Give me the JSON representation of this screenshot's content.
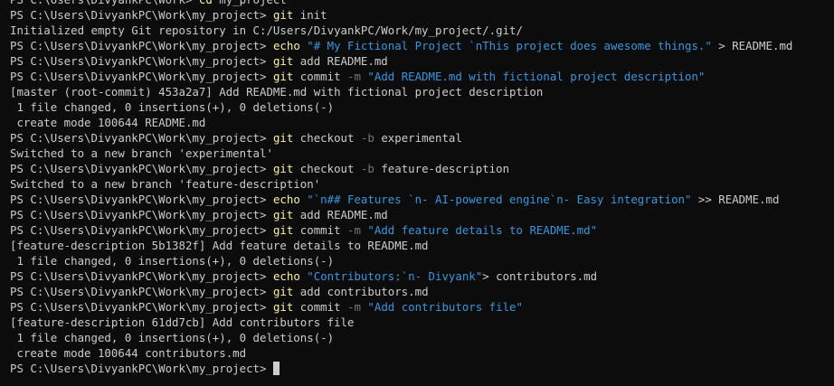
{
  "colors": {
    "background": "#0c0c0c",
    "foreground": "#cccccc",
    "command": "#f9f1a5",
    "string": "#3a96dd",
    "parameter": "#767676"
  },
  "lines": [
    [
      {
        "k": "prompt",
        "t": "PS C:\\Users\\DivyankPC\\Work> "
      },
      {
        "k": "cmd",
        "t": "cd"
      },
      {
        "k": "arg",
        "t": " my_project"
      }
    ],
    [
      {
        "k": "prompt",
        "t": "PS C:\\Users\\DivyankPC\\Work\\my_project> "
      },
      {
        "k": "cmd",
        "t": "git"
      },
      {
        "k": "arg",
        "t": " init"
      }
    ],
    [
      {
        "k": "out",
        "t": "Initialized empty Git repository in C:/Users/DivyankPC/Work/my_project/.git/"
      }
    ],
    [
      {
        "k": "prompt",
        "t": "PS C:\\Users\\DivyankPC\\Work\\my_project> "
      },
      {
        "k": "cmd",
        "t": "echo"
      },
      {
        "k": "arg",
        "t": " "
      },
      {
        "k": "str",
        "t": "\"# My Fictional Project `nThis project does awesome things.\""
      },
      {
        "k": "arg",
        "t": " > README.md"
      }
    ],
    [
      {
        "k": "prompt",
        "t": "PS C:\\Users\\DivyankPC\\Work\\my_project> "
      },
      {
        "k": "cmd",
        "t": "git"
      },
      {
        "k": "arg",
        "t": " add README.md"
      }
    ],
    [
      {
        "k": "prompt",
        "t": "PS C:\\Users\\DivyankPC\\Work\\my_project> "
      },
      {
        "k": "cmd",
        "t": "git"
      },
      {
        "k": "arg",
        "t": " commit "
      },
      {
        "k": "flag",
        "t": "-m"
      },
      {
        "k": "arg",
        "t": " "
      },
      {
        "k": "str",
        "t": "\"Add README.md with fictional project description\""
      }
    ],
    [
      {
        "k": "out",
        "t": "[master (root-commit) 453a2a7] Add README.md with fictional project description"
      }
    ],
    [
      {
        "k": "out",
        "t": " 1 file changed, 0 insertions(+), 0 deletions(-)"
      }
    ],
    [
      {
        "k": "out",
        "t": " create mode 100644 README.md"
      }
    ],
    [
      {
        "k": "prompt",
        "t": "PS C:\\Users\\DivyankPC\\Work\\my_project> "
      },
      {
        "k": "cmd",
        "t": "git"
      },
      {
        "k": "arg",
        "t": " checkout "
      },
      {
        "k": "flag",
        "t": "-b"
      },
      {
        "k": "arg",
        "t": " experimental"
      }
    ],
    [
      {
        "k": "out",
        "t": "Switched to a new branch 'experimental'"
      }
    ],
    [
      {
        "k": "prompt",
        "t": "PS C:\\Users\\DivyankPC\\Work\\my_project> "
      },
      {
        "k": "cmd",
        "t": "git"
      },
      {
        "k": "arg",
        "t": " checkout "
      },
      {
        "k": "flag",
        "t": "-b"
      },
      {
        "k": "arg",
        "t": " feature-description"
      }
    ],
    [
      {
        "k": "out",
        "t": "Switched to a new branch 'feature-description'"
      }
    ],
    [
      {
        "k": "prompt",
        "t": "PS C:\\Users\\DivyankPC\\Work\\my_project> "
      },
      {
        "k": "cmd",
        "t": "echo"
      },
      {
        "k": "arg",
        "t": " "
      },
      {
        "k": "str",
        "t": "\"`n## Features `n- AI-powered engine`n- Easy integration\""
      },
      {
        "k": "arg",
        "t": " >> README.md"
      }
    ],
    [
      {
        "k": "prompt",
        "t": "PS C:\\Users\\DivyankPC\\Work\\my_project> "
      },
      {
        "k": "cmd",
        "t": "git"
      },
      {
        "k": "arg",
        "t": " add README.md"
      }
    ],
    [
      {
        "k": "prompt",
        "t": "PS C:\\Users\\DivyankPC\\Work\\my_project> "
      },
      {
        "k": "cmd",
        "t": "git"
      },
      {
        "k": "arg",
        "t": " commit "
      },
      {
        "k": "flag",
        "t": "-m"
      },
      {
        "k": "arg",
        "t": " "
      },
      {
        "k": "str",
        "t": "\"Add feature details to README.md\""
      }
    ],
    [
      {
        "k": "out",
        "t": "[feature-description 5b1382f] Add feature details to README.md"
      }
    ],
    [
      {
        "k": "out",
        "t": " 1 file changed, 0 insertions(+), 0 deletions(-)"
      }
    ],
    [
      {
        "k": "prompt",
        "t": "PS C:\\Users\\DivyankPC\\Work\\my_project> "
      },
      {
        "k": "cmd",
        "t": "echo"
      },
      {
        "k": "arg",
        "t": " "
      },
      {
        "k": "str",
        "t": "\"Contributors:`n- Divyank\""
      },
      {
        "k": "arg",
        "t": "> contributors.md"
      }
    ],
    [
      {
        "k": "prompt",
        "t": "PS C:\\Users\\DivyankPC\\Work\\my_project> "
      },
      {
        "k": "cmd",
        "t": "git"
      },
      {
        "k": "arg",
        "t": " add contributors.md"
      }
    ],
    [
      {
        "k": "prompt",
        "t": "PS C:\\Users\\DivyankPC\\Work\\my_project> "
      },
      {
        "k": "cmd",
        "t": "git"
      },
      {
        "k": "arg",
        "t": " commit "
      },
      {
        "k": "flag",
        "t": "-m"
      },
      {
        "k": "arg",
        "t": " "
      },
      {
        "k": "str",
        "t": "\"Add contributors file\""
      }
    ],
    [
      {
        "k": "out",
        "t": "[feature-description 61dd7cb] Add contributors file"
      }
    ],
    [
      {
        "k": "out",
        "t": " 1 file changed, 0 insertions(+), 0 deletions(-)"
      }
    ],
    [
      {
        "k": "out",
        "t": " create mode 100644 contributors.md"
      }
    ],
    [
      {
        "k": "prompt",
        "t": "PS C:\\Users\\DivyankPC\\Work\\my_project> "
      }
    ]
  ]
}
